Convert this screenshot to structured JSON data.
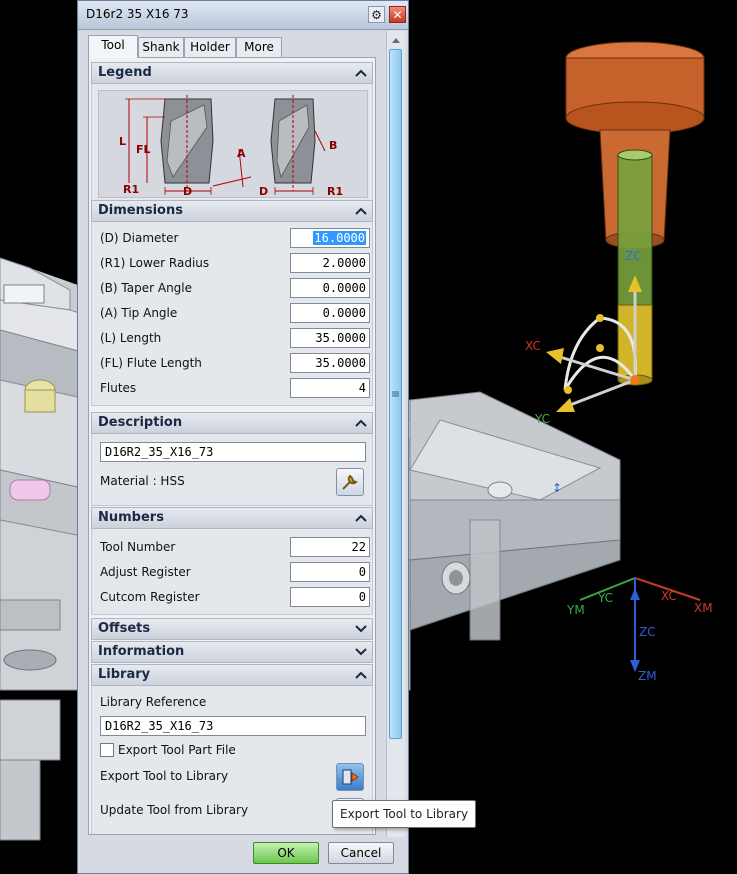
{
  "window": {
    "title": "D16r2 35 X16 73"
  },
  "tabs": [
    {
      "label": "Tool",
      "active": true
    },
    {
      "label": "Shank",
      "active": false
    },
    {
      "label": "Holder",
      "active": false
    },
    {
      "label": "More",
      "active": false
    }
  ],
  "legend": {
    "header": "Legend",
    "labels": {
      "L": "L",
      "FL": "FL",
      "R1": "R1",
      "D": "D",
      "A": "A",
      "B": "B"
    }
  },
  "dimensions": {
    "header": "Dimensions",
    "rows": [
      {
        "label": "(D) Diameter",
        "value": "16.0000"
      },
      {
        "label": "(R1) Lower Radius",
        "value": "2.0000"
      },
      {
        "label": "(B) Taper Angle",
        "value": "0.0000"
      },
      {
        "label": "(A) Tip Angle",
        "value": "0.0000"
      },
      {
        "label": "(L) Length",
        "value": "35.0000"
      },
      {
        "label": "(FL) Flute Length",
        "value": "35.0000"
      },
      {
        "label": "Flutes",
        "value": "4"
      }
    ]
  },
  "description": {
    "header": "Description",
    "text": "D16R2_35_X16_73",
    "material": "Material : HSS"
  },
  "numbers": {
    "header": "Numbers",
    "rows": [
      {
        "label": "Tool Number",
        "value": "22"
      },
      {
        "label": "Adjust Register",
        "value": "0"
      },
      {
        "label": "Cutcom Register",
        "value": "0"
      }
    ]
  },
  "offsets": {
    "header": "Offsets"
  },
  "information": {
    "header": "Information"
  },
  "library": {
    "header": "Library",
    "reference_label": "Library Reference",
    "reference_value": "D16R2_35_X16_73",
    "export_part_label": "Export Tool Part File",
    "export_part_checked": false,
    "export_label": "Export Tool to Library",
    "update_label": "Update Tool from Library"
  },
  "footer": {
    "ok": "OK",
    "cancel": "Cancel"
  },
  "tooltip": "Export Tool to Library",
  "viewport": {
    "tool_axes": {
      "xc": "XC",
      "yc": "YC",
      "zc": "ZC"
    },
    "world_axes": {
      "ym": "YM",
      "yc": "YC",
      "xc": "XC",
      "xm": "XM",
      "zc": "ZC",
      "zm": "ZM"
    }
  },
  "colors": {
    "dialog_bg": "#d6dbe3",
    "selection": "#3399ff",
    "ok_green": "#6cc64e",
    "holder_orange": "#c8622c",
    "shank_green": "#6f9a3a",
    "axis_red": "#d03020",
    "axis_green": "#40b040",
    "axis_blue": "#3060e0"
  }
}
